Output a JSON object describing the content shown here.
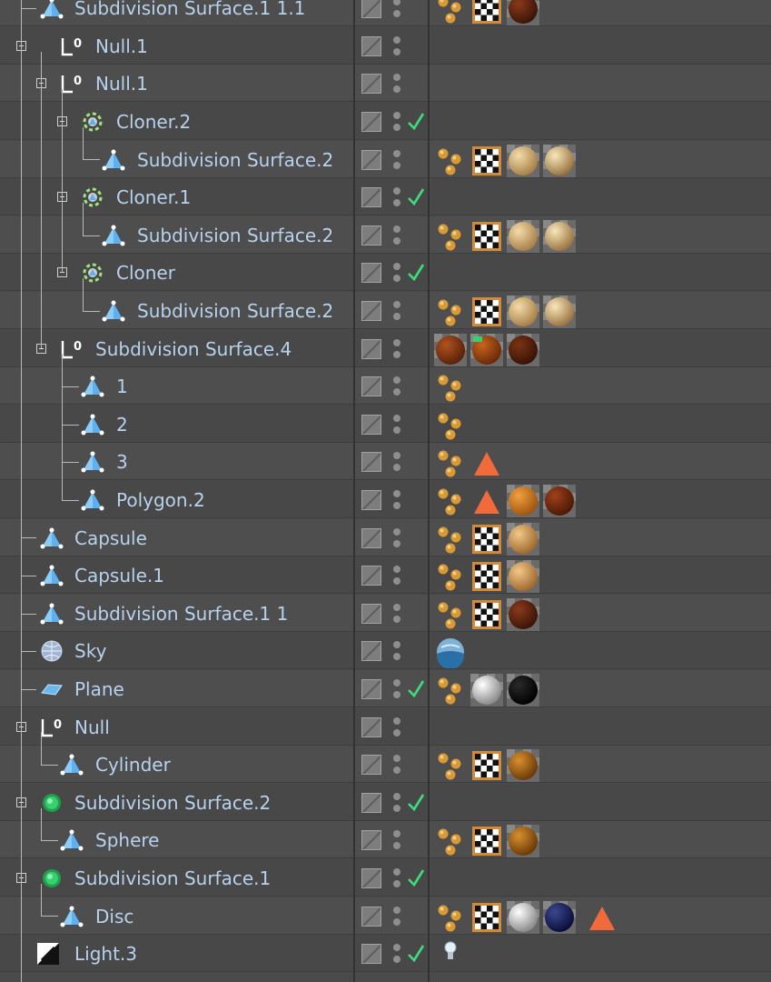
{
  "rows": [
    {
      "name": "Subdivision Surface.1 1.1",
      "icon": "polygon-icon",
      "check": false,
      "tags": [
        "phong-tag-icon",
        "uvw-tag-icon",
        "material-dark-wood"
      ]
    },
    {
      "name": "Null.1",
      "icon": "null-icon",
      "check": false,
      "tags": []
    },
    {
      "name": "Null.1",
      "icon": "null-icon",
      "check": false,
      "tags": []
    },
    {
      "name": "Cloner.2",
      "icon": "cloner-icon",
      "check": true,
      "tags": []
    },
    {
      "name": "Subdivision Surface.2",
      "icon": "polygon-icon",
      "check": false,
      "tags": [
        "phong-tag-icon",
        "uvw-tag-icon",
        "material-beige",
        "material-beige-shiny"
      ]
    },
    {
      "name": "Cloner.1",
      "icon": "cloner-icon",
      "check": true,
      "tags": []
    },
    {
      "name": "Subdivision Surface.2",
      "icon": "polygon-icon",
      "check": false,
      "tags": [
        "phong-tag-icon",
        "uvw-tag-icon",
        "material-beige",
        "material-beige-shiny"
      ]
    },
    {
      "name": "Cloner",
      "icon": "cloner-icon",
      "check": true,
      "tags": []
    },
    {
      "name": "Subdivision Surface.2",
      "icon": "polygon-icon",
      "check": false,
      "tags": [
        "phong-tag-icon",
        "uvw-tag-icon",
        "material-beige",
        "material-beige-shiny"
      ]
    },
    {
      "name": "Subdivision Surface.4",
      "icon": "null-icon",
      "check": false,
      "tags": [
        "material-rust",
        "material-rust-selected",
        "material-dark-rust"
      ]
    },
    {
      "name": "1",
      "icon": "polygon-icon",
      "check": false,
      "tags": [
        "phong-tag-icon"
      ]
    },
    {
      "name": "2",
      "icon": "polygon-icon",
      "check": false,
      "tags": [
        "phong-tag-icon"
      ]
    },
    {
      "name": "3",
      "icon": "polygon-icon",
      "check": false,
      "tags": [
        "phong-tag-icon",
        "selection-tag-icon"
      ]
    },
    {
      "name": "Polygon.2",
      "icon": "polygon-icon",
      "check": false,
      "tags": [
        "phong-tag-icon",
        "selection-tag-icon",
        "material-checker-orange",
        "material-checker-brown"
      ]
    },
    {
      "name": "Capsule",
      "icon": "polygon-icon",
      "check": false,
      "tags": [
        "phong-tag-icon",
        "uvw-tag-icon",
        "material-tan"
      ]
    },
    {
      "name": "Capsule.1",
      "icon": "polygon-icon",
      "check": false,
      "tags": [
        "phong-tag-icon",
        "uvw-tag-icon",
        "material-tan"
      ]
    },
    {
      "name": "Subdivision Surface.1 1",
      "icon": "polygon-icon",
      "check": false,
      "tags": [
        "phong-tag-icon",
        "uvw-tag-icon",
        "material-dark-wood"
      ]
    },
    {
      "name": "Sky",
      "icon": "sky-icon",
      "check": false,
      "tags": [
        "sky-tag-icon"
      ]
    },
    {
      "name": "Plane",
      "icon": "plane-icon",
      "check": true,
      "tags": [
        "phong-tag-icon",
        "material-white",
        "material-black"
      ]
    },
    {
      "name": "Null",
      "icon": "null-icon",
      "check": false,
      "tags": []
    },
    {
      "name": "Cylinder",
      "icon": "polygon-icon",
      "check": false,
      "tags": [
        "phong-tag-icon",
        "uvw-tag-icon",
        "material-gold"
      ]
    },
    {
      "name": "Subdivision Surface.2",
      "icon": "subdivision-icon",
      "check": true,
      "tags": []
    },
    {
      "name": "Sphere",
      "icon": "polygon-icon",
      "check": false,
      "tags": [
        "phong-tag-icon",
        "uvw-tag-icon",
        "material-gold"
      ]
    },
    {
      "name": "Subdivision Surface.1",
      "icon": "subdivision-icon",
      "check": true,
      "tags": []
    },
    {
      "name": "Disc",
      "icon": "polygon-icon",
      "check": false,
      "tags": [
        "phong-tag-icon",
        "uvw-tag-icon",
        "material-white",
        "material-navy",
        "selection-tag-icon"
      ]
    },
    {
      "name": "Light.3",
      "icon": "light-icon",
      "check": true,
      "tags": [
        "light-tag-icon"
      ]
    }
  ],
  "colors": {
    "name_text": "#b8d2ee",
    "check": "#3fdc7c",
    "selection_tag": "#f06a3c"
  }
}
